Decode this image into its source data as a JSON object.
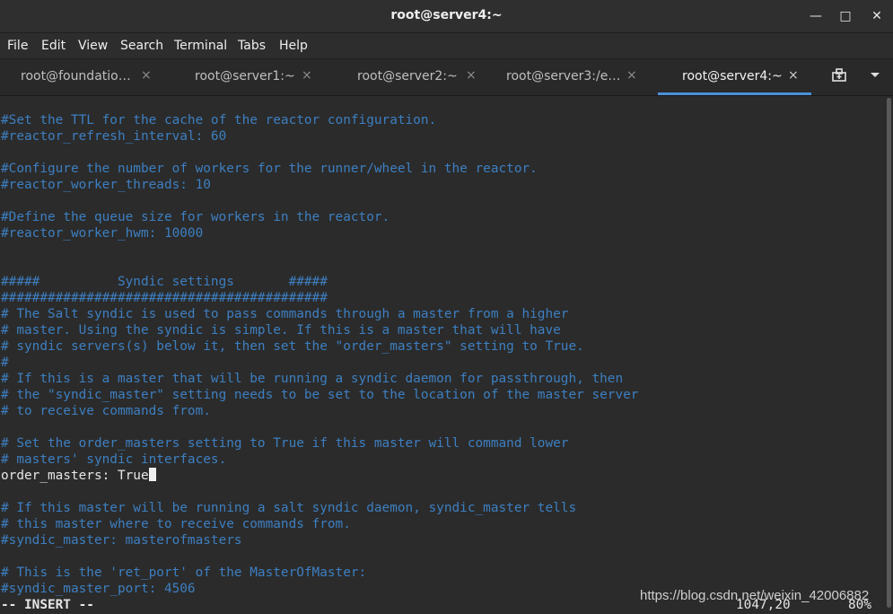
{
  "window": {
    "title": "root@server4:~",
    "minimize_glyph": "—",
    "maximize_glyph": "□",
    "close_glyph": "✕"
  },
  "menubar": {
    "items": [
      "File",
      "Edit",
      "View",
      "Search",
      "Terminal",
      "Tabs",
      "Help"
    ]
  },
  "tabs": [
    {
      "label": "root@foundatio…",
      "close": "×",
      "active": false
    },
    {
      "label": "root@server1:~",
      "close": "×",
      "active": false
    },
    {
      "label": "root@server2:~",
      "close": "×",
      "active": false
    },
    {
      "label": "root@server3:/e…",
      "close": "×",
      "active": false
    },
    {
      "label": "root@server4:~",
      "close": "×",
      "active": true
    }
  ],
  "tab_tools": {
    "new_tab_icon": "new-tab-icon",
    "menu_icon": "chevron-down-icon"
  },
  "terminal": {
    "lines": [
      "#Set the TTL for the cache of the reactor configuration.",
      "#reactor_refresh_interval: 60",
      "",
      "#Configure the number of workers for the runner/wheel in the reactor.",
      "#reactor_worker_threads: 10",
      "",
      "#Define the queue size for workers in the reactor.",
      "#reactor_worker_hwm: 10000",
      "",
      "",
      "#####          Syndic settings       #####",
      "##########################################",
      "# The Salt syndic is used to pass commands through a master from a higher",
      "# master. Using the syndic is simple. If this is a master that will have",
      "# syndic servers(s) below it, then set the \"order_masters\" setting to True.",
      "#",
      "# If this is a master that will be running a syndic daemon for passthrough, then",
      "# the \"syndic_master\" setting needs to be set to the location of the master server",
      "# to receive commands from.",
      "",
      "# Set the order_masters setting to True if this master will command lower",
      "# masters' syndic interfaces.",
      "order_masters: True",
      "",
      "# If this master will be running a salt syndic daemon, syndic_master tells",
      "# this master where to receive commands from.",
      "#syndic_master: masterofmasters",
      "",
      "# This is the 'ret_port' of the MasterOfMaster:",
      "#syndic_master_port: 4506"
    ],
    "plain_line_index": 22,
    "mode": "-- INSERT --",
    "cursor_position": "1047,20",
    "scroll_percent": "80%"
  },
  "watermark": "https://blog.csdn.net/weixin_42006882",
  "colors": {
    "comment": "#3d7fc1",
    "text": "#e6e6e6",
    "background": "#2b2b2b",
    "active_tab_underline": "#4a90d9"
  }
}
